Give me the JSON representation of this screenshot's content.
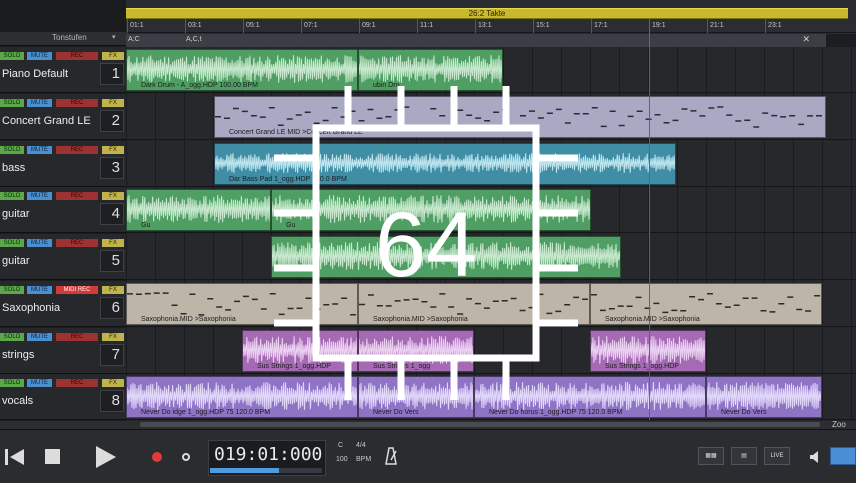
{
  "header": {
    "loop_label": "26:2 Takte",
    "track_label": "Tonstufen",
    "track_label_arrow": "▾",
    "ruler_bars": [
      "01:1",
      "03:1",
      "05:1",
      "07:1",
      "09:1",
      "11:1",
      "13:1",
      "15:1",
      "17:1",
      "19:1",
      "21:1",
      "23:1"
    ],
    "markers": [
      "A:C",
      "A,C,t"
    ],
    "marker_close": "✕"
  },
  "tracks": [
    {
      "name": "Piano Default",
      "number": "1",
      "solo": "SOLO",
      "mute": "MUTE",
      "rec": "REC",
      "fx": "FX"
    },
    {
      "name": "Concert Grand LE",
      "number": "2",
      "solo": "SOLO",
      "mute": "MUTE",
      "rec": "REC",
      "fx": "FX"
    },
    {
      "name": "bass",
      "number": "3",
      "solo": "SOLO",
      "mute": "MUTE",
      "rec": "REC",
      "fx": "FX"
    },
    {
      "name": "guitar",
      "number": "4",
      "solo": "SOLO",
      "mute": "MUTE",
      "rec": "REC",
      "fx": "FX"
    },
    {
      "name": "guitar",
      "number": "5",
      "solo": "SOLO",
      "mute": "MUTE",
      "rec": "REC",
      "fx": "FX"
    },
    {
      "name": "Saxophonia",
      "number": "6",
      "solo": "SOLO",
      "mute": "MUTE",
      "rec": "MIDI REC",
      "fx": "FX"
    },
    {
      "name": "strings",
      "number": "7",
      "solo": "SOLO",
      "mute": "MUTE",
      "rec": "REC",
      "fx": "FX"
    },
    {
      "name": "vocals",
      "number": "8",
      "solo": "SOLO",
      "mute": "MUTE",
      "rec": "REC",
      "fx": "FX"
    }
  ],
  "clips": {
    "piano": [
      "Dark Drum - A_ogg.HDP 100.00 BPM",
      "ubin Dru"
    ],
    "grand": [
      "Concert Grand LE MID >Concert Grand LE"
    ],
    "bass": [
      "Dar  Bass Pad 1_ogg.HDP  100.0 BPM",
      "Dar  Bass Pad 1_ogg.HDP  100.0 BPM"
    ],
    "guitar4": [
      "Gu",
      "Gu"
    ],
    "sax": [
      "Saxophonia.MID >Saxophonia",
      "Saxophonia.MID >Saxophonia",
      "Saxophonia.MID >Saxophonia"
    ],
    "strings": [
      "Sus Strings 1_ogg.HDP",
      "Sus Strings 1_ogg",
      "Sus Strings 1_ogg.HDP"
    ],
    "vocals": [
      "Never  Do  idge 1_ogg.HDP  75  120.0 BPM",
      "Never Do Vers",
      "Never  Do  horus 1_ogg.HDP  75  120.0 BPM",
      "Never  Do Vers"
    ]
  },
  "transport": {
    "time": "019:01:000",
    "progress": 0.62,
    "key_label": "C",
    "signature": "4/4",
    "tempo": "100",
    "tempo_unit": "BPM",
    "btn_a": "▦▦",
    "btn_b": "▤",
    "btn_c": "LIVE",
    "zoom_label": "Zoo"
  },
  "overlay": {
    "cpu_label": "64"
  },
  "colors": {
    "green_clip": "#4f9e63",
    "lavender_clip": "#a9a9c4",
    "teal_clip": "#3f8ea5",
    "sax_clip": "#bdb5a8",
    "strings_clip": "#a46ab3",
    "vocals_clip": "#8f74c6",
    "playhead": "#e23030",
    "loop": "#c9b92f"
  }
}
